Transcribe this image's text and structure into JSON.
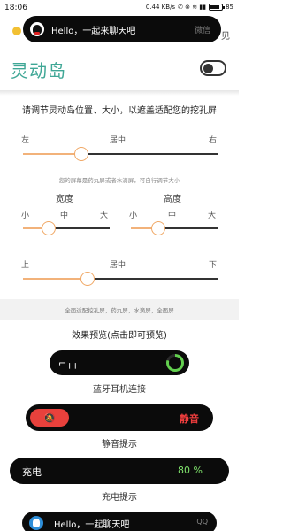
{
  "status_bar": {
    "time": "18:06",
    "net_speed": "0.44 KB/s",
    "indicators": "✆ ⊗ ≋ ▮▮",
    "battery": "85",
    "battery_level": 0.85
  },
  "floating_island": {
    "message": "Hello，一起来聊天吧",
    "app": "微信",
    "peek_right": "见"
  },
  "header": {
    "title": "灵动岛",
    "toggle_on": false
  },
  "instructions": "请调节灵动岛位置、大小，以遮盖适配您的挖孔屏",
  "position_slider": {
    "left_label": "左",
    "center_label": "居中",
    "right_label": "右",
    "value": 0.3
  },
  "size_hint": "您的屏幕是药丸屏或者水滴屏，可自行调节大小",
  "width_slider": {
    "title": "宽度",
    "min_label": "小",
    "mid_label": "中",
    "max_label": "大",
    "value": 0.3
  },
  "height_slider": {
    "title": "高度",
    "min_label": "小",
    "mid_label": "中",
    "max_label": "大",
    "value": 0.32
  },
  "vertical_slider": {
    "top_label": "上",
    "center_label": "居中",
    "bottom_label": "下",
    "value": 0.33
  },
  "compat_note": "全面适配挖孔屏，药丸屏，水滴屏，全面屏",
  "preview": {
    "title": "效果预览(点击即可预览)",
    "bluetooth": {
      "icon": "earbuds-icon",
      "progress": 0.8,
      "caption": "蓝牙耳机连接"
    },
    "mute": {
      "label": "静音",
      "caption": "静音提示",
      "accent": "#e8413c"
    },
    "charging": {
      "label": "充电",
      "percent": "80 %",
      "caption": "充电提示",
      "accent": "#7ee06b"
    },
    "message": {
      "text": "Hello，一起聊天吧",
      "app": "QQ"
    }
  }
}
